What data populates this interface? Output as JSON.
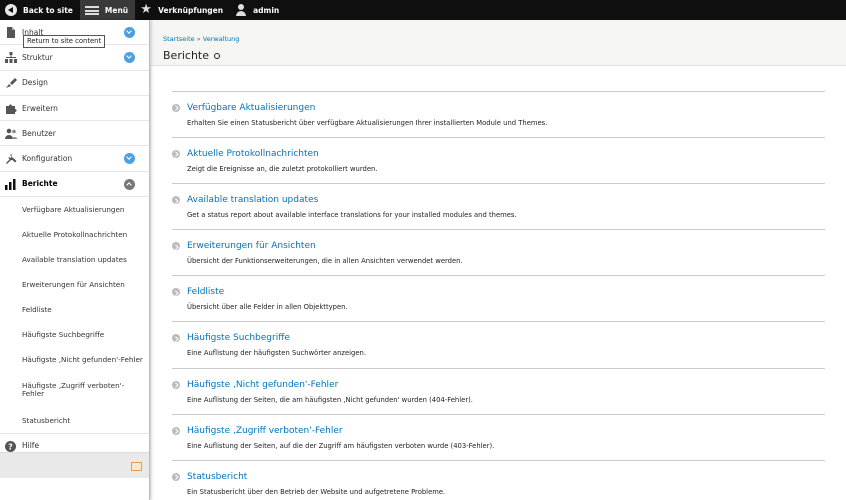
{
  "toolbar": {
    "back_label": "Back to site",
    "menu_label": "Menü",
    "shortcuts_label": "Verknüpfungen",
    "user_label": "admin"
  },
  "tooltip": {
    "text": "Return to site content"
  },
  "sidebar": {
    "items": [
      {
        "label": "Inhalt",
        "icon": "file-icon",
        "expandable": true
      },
      {
        "label": "Struktur",
        "icon": "sitemap-icon",
        "expandable": true
      },
      {
        "label": "Design",
        "icon": "brush-icon",
        "expandable": false
      },
      {
        "label": "Erweitern",
        "icon": "puzzle-icon",
        "expandable": false
      },
      {
        "label": "Benutzer",
        "icon": "people-icon",
        "expandable": false
      },
      {
        "label": "Konfiguration",
        "icon": "wrench-icon",
        "expandable": true
      },
      {
        "label": "Berichte",
        "icon": "bar-chart-icon",
        "expandable": true,
        "expanded": true
      }
    ],
    "subitems": [
      "Verfügbare Aktualisierungen",
      "Aktuelle Protokollnachrichten",
      "Available translation updates",
      "Erweiterungen für Ansichten",
      "Feldliste",
      "Häufigste Suchbegriffe",
      "Häufigste ‚Nicht gefunden'-Fehler",
      "Häufigste ‚Zugriff verboten'-Fehler",
      "Statusbericht"
    ],
    "help_label": "Hilfe"
  },
  "header": {
    "breadcrumb": [
      "Startseite",
      "Verwaltung"
    ],
    "breadcrumb_sep": "»",
    "title": "Berichte"
  },
  "reports": [
    {
      "title": "Verfügbare Aktualisierungen",
      "description": "Erhalten Sie einen Statusbericht über verfügbare Aktualisierungen Ihrer installierten Module und Themes."
    },
    {
      "title": "Aktuelle Protokollnachrichten",
      "description": "Zeigt die Ereignisse an, die zuletzt protokolliert wurden."
    },
    {
      "title": "Available translation updates",
      "description": "Get a status report about available interface translations for your installed modules and themes."
    },
    {
      "title": "Erweiterungen für Ansichten",
      "description": "Übersicht der Funktionserweiterungen, die in allen Ansichten verwendet werden."
    },
    {
      "title": "Feldliste",
      "description": "Übersicht über alle Felder in allen Objekttypen."
    },
    {
      "title": "Häufigste Suchbegriffe",
      "description": "Eine Auflistung der häufigsten Suchwörter anzeigen."
    },
    {
      "title": "Häufigste ‚Nicht gefunden'-Fehler",
      "description": "Eine Auflistung der Seiten, die am häufigsten ‚Nicht gefunden' wurden (404-Fehler)."
    },
    {
      "title": "Häufigste ‚Zugriff verboten'-Fehler",
      "description": "Eine Auflistung der Seiten, auf die der Zugriff am häufigsten verboten wurde (403-Fehler)."
    },
    {
      "title": "Statusbericht",
      "description": "Ein Statusbericht über den Betrieb der Website und aufgetretene Probleme."
    }
  ],
  "colors": {
    "link": "#0074bd",
    "toggle": "#4c9fe1",
    "toolbar": "#0f0f0f"
  }
}
